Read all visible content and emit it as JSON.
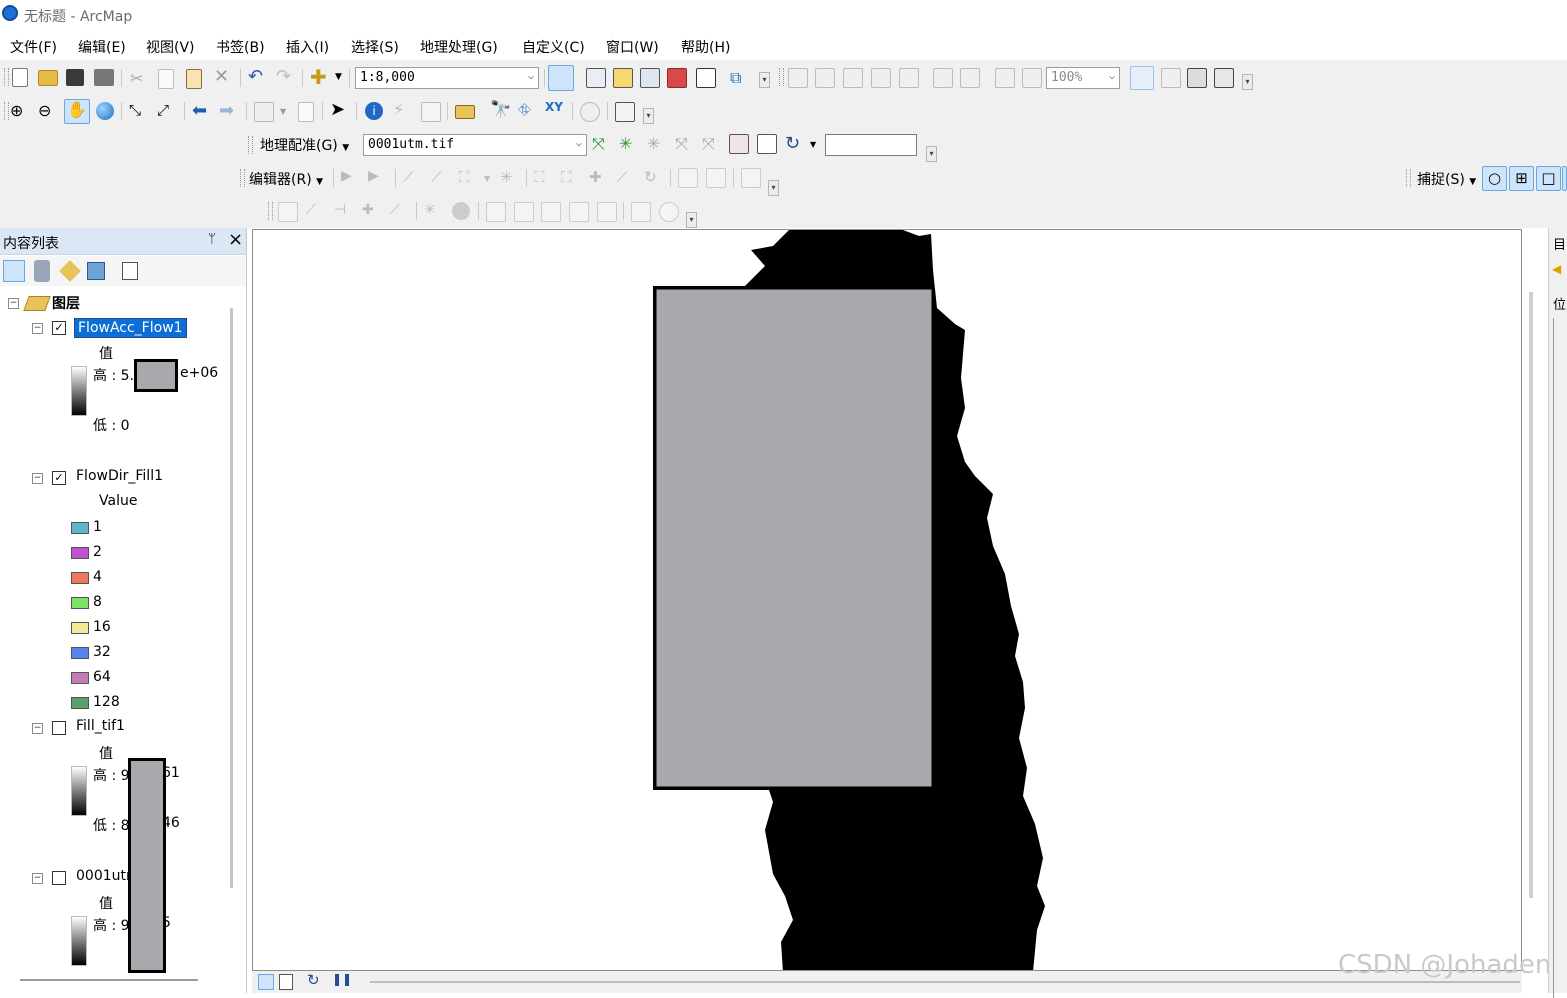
{
  "window": {
    "title": "无标题 - ArcMap"
  },
  "menu": [
    "文件(F)",
    "编辑(E)",
    "视图(V)",
    "书签(B)",
    "插入(I)",
    "选择(S)",
    "地理处理(G)",
    "自定义(C)",
    "窗口(W)",
    "帮助(H)"
  ],
  "toolbar": {
    "scale_value": "1:8,000",
    "zoom_value": "100%",
    "georef_label": "地理配准(G)",
    "georef_layer": "0001utm.tif",
    "editor_label": "编辑器(R)",
    "snapping_label": "捕捉(S)"
  },
  "toc": {
    "title": "内容列表",
    "pin_glyph": "ᛘ",
    "close_glyph": "×",
    "root_label": "图层",
    "layers": {
      "flowacc": {
        "name": "FlowAcc_Flow1",
        "field": "值",
        "high": "高 : 5.",
        "high_suffix": "e+06",
        "low": "低 : 0",
        "checked": true
      },
      "flowdir": {
        "name": "FlowDir_Fill1",
        "field": "Value",
        "checked": true,
        "classes": [
          {
            "label": "1",
            "color": "#5fb6c6"
          },
          {
            "label": "2",
            "color": "#c34fd6"
          },
          {
            "label": "4",
            "color": "#ef7a5b"
          },
          {
            "label": "8",
            "color": "#7ee26d"
          },
          {
            "label": "16",
            "color": "#eeea9a"
          },
          {
            "label": "32",
            "color": "#5b83f0"
          },
          {
            "label": "64",
            "color": "#c77bb0"
          },
          {
            "label": "128",
            "color": "#5a9e6e"
          }
        ]
      },
      "fill": {
        "name": "Fill_tif1",
        "field": "值",
        "high": "高 : 9",
        "high_suffix": "61",
        "low": "低 : 8",
        "low_suffix": "46",
        "checked": false
      },
      "utm": {
        "name": "0001utm",
        "field": "值",
        "high": "高 : 9",
        "high_suffix": "5",
        "checked": false
      }
    }
  },
  "right_panel": {
    "tab1": "目",
    "tab2": "位"
  },
  "watermark": "CSDN @Johaden",
  "colors": {
    "redaction": "#a8a9ad",
    "raster": "#000000",
    "toc_header": "#dce7f5",
    "selected_layer": "#0a6fd6"
  }
}
